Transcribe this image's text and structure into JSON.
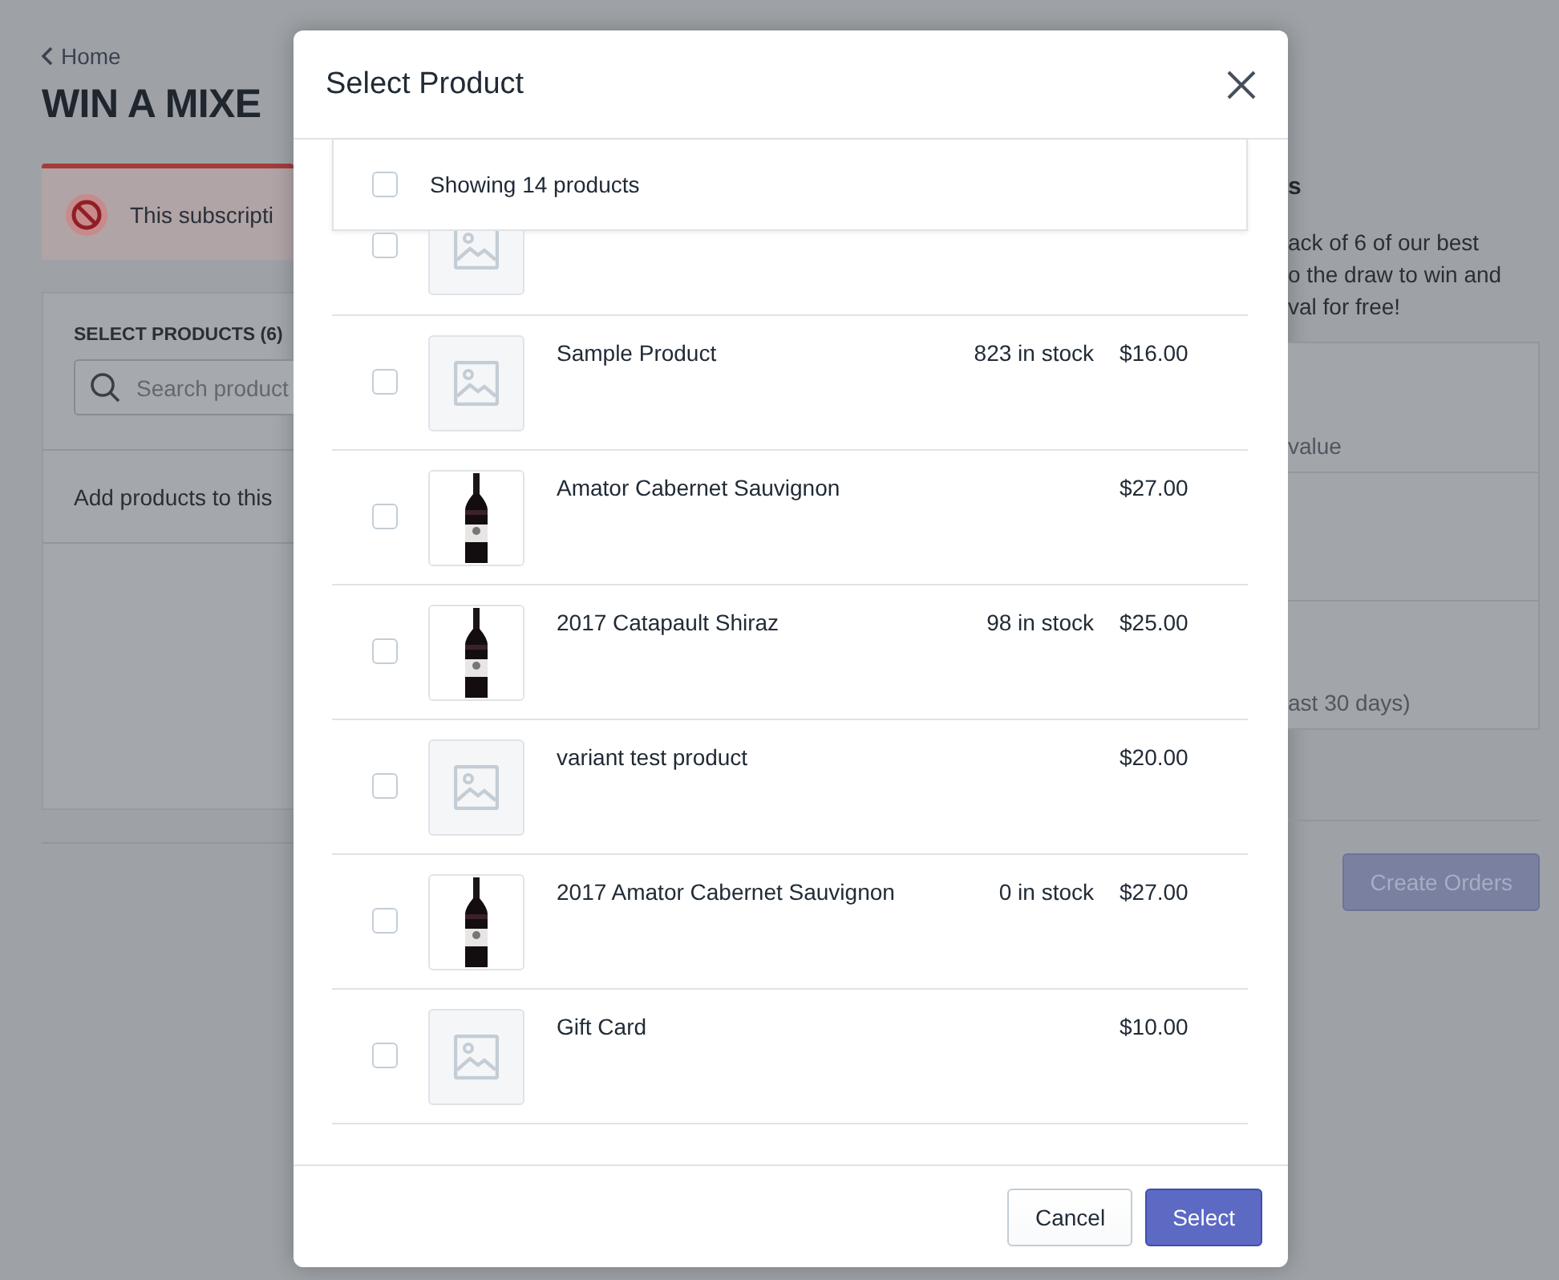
{
  "page": {
    "back_link": "Home",
    "title": "WIN A MIXE",
    "alert": {
      "text": "This subscripti"
    },
    "select_products": {
      "heading": "SELECT PRODUCTS (6)",
      "search": {
        "placeholder": "Search product"
      },
      "empty_text": "Add products to this"
    },
    "description": {
      "heading": "s",
      "lines": [
        "ack of 6 of our best",
        "o the draw to win and",
        "val for free!"
      ]
    },
    "stat_sections": [
      {
        "kind": "note",
        "note": "value"
      },
      {
        "kind": "blank"
      },
      {
        "kind": "note",
        "note": "ast 30 days)"
      }
    ],
    "create_button": {
      "label": "Create Orders",
      "disabled": true
    }
  },
  "modal": {
    "title": "Select Product",
    "select_all": {
      "label": "Showing 14 products",
      "checked": false
    },
    "products": [
      {
        "cut_off": true,
        "kind": "placeholder",
        "checked": false
      },
      {
        "cut_off": false,
        "kind": "placeholder",
        "checked": false,
        "name": "Sample Product",
        "stock": "823 in stock",
        "price": "$16.00"
      },
      {
        "cut_off": false,
        "checked": false,
        "name": "Amator Cabernet Sauvignon",
        "price": "$27.00"
      },
      {
        "cut_off": false,
        "checked": false,
        "name": "2017 Catapault Shiraz",
        "stock": "98 in stock",
        "price": "$25.00"
      },
      {
        "cut_off": false,
        "kind": "placeholder",
        "checked": false,
        "name": "variant test product",
        "price": "$20.00"
      },
      {
        "cut_off": false,
        "checked": false,
        "name": "2017 Amator Cabernet Sauvignon",
        "stock": "0 in stock",
        "price": "$27.00"
      },
      {
        "cut_off": false,
        "kind": "placeholder",
        "checked": false,
        "name": "Gift Card",
        "price": "$10.00"
      }
    ],
    "buttons": [
      {
        "label": "Cancel",
        "kind": "secondary"
      },
      {
        "label": "Select",
        "kind": "primary"
      }
    ]
  }
}
